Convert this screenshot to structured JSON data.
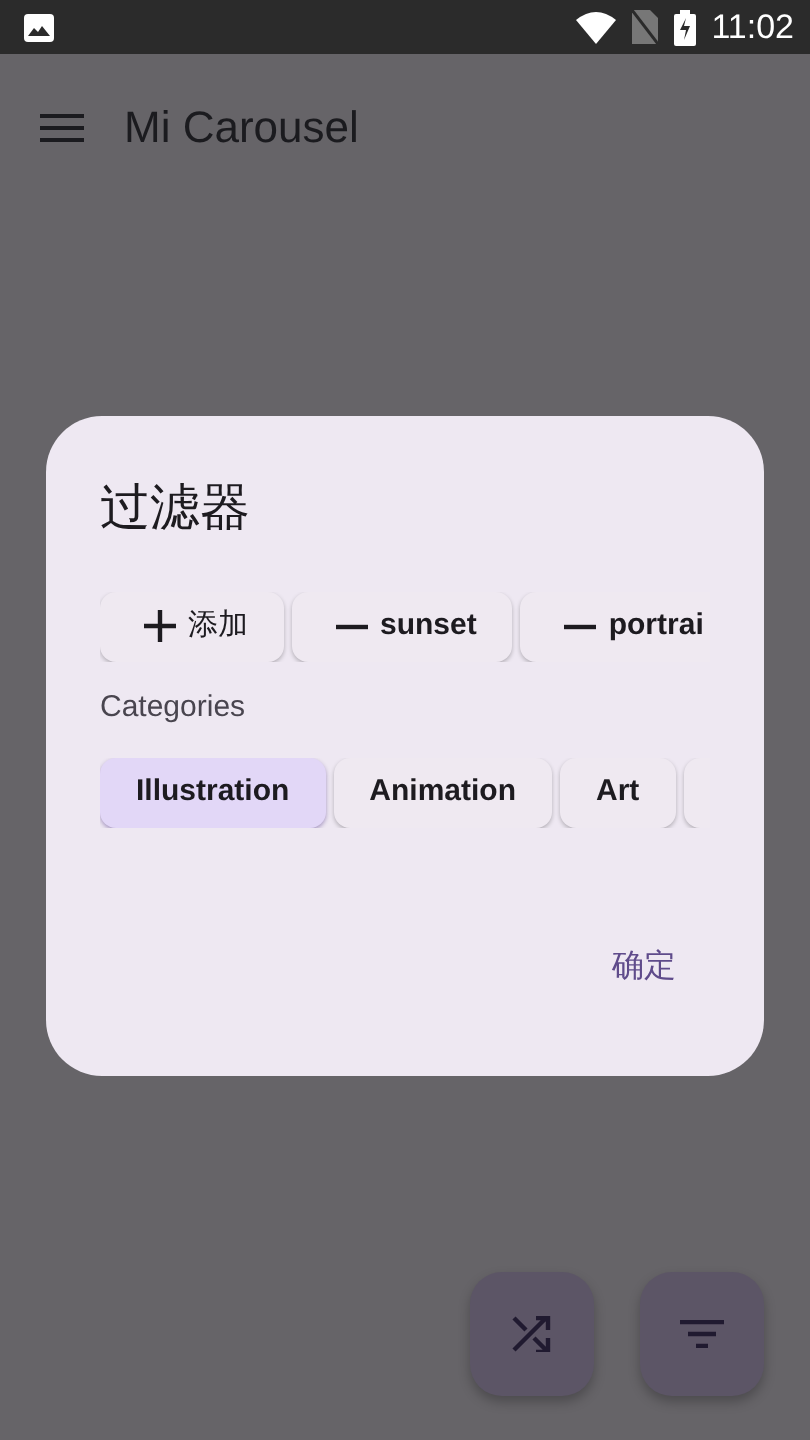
{
  "status_bar": {
    "time": "11:02"
  },
  "app_bar": {
    "title": "Mi Carousel"
  },
  "dialog": {
    "title": "过滤器",
    "tags": [
      {
        "kind": "add",
        "label": "添加"
      },
      {
        "kind": "remove",
        "label": "sunset"
      },
      {
        "kind": "remove",
        "label": "portrai"
      }
    ],
    "categories_label": "Categories",
    "categories": [
      {
        "label": "Illustration",
        "selected": true
      },
      {
        "label": "Animation",
        "selected": false
      },
      {
        "label": "Art",
        "selected": false
      }
    ],
    "confirm": "确定"
  }
}
